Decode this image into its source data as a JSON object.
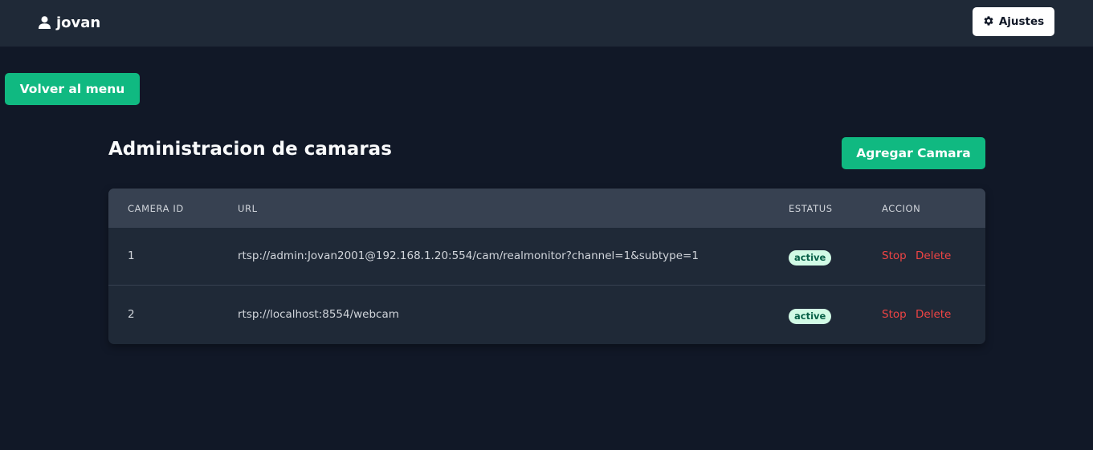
{
  "header": {
    "username": "jovan",
    "user_icon": "user-icon",
    "settings_icon": "gear-icon",
    "settings_label": "Ajustes"
  },
  "back_button_label": "Volver al menu",
  "page": {
    "title": "Administracion de camaras",
    "add_button_label": "Agregar Camara"
  },
  "table": {
    "columns": [
      "CAMERA ID",
      "URL",
      "ESTATUS",
      "ACCION"
    ],
    "rows": [
      {
        "id": "1",
        "url": "rtsp://admin:Jovan2001@192.168.1.20:554/cam/realmonitor?channel=1&subtype=1",
        "status": "active",
        "actions": [
          "Stop",
          "Delete"
        ]
      },
      {
        "id": "2",
        "url": "rtsp://localhost:8554/webcam",
        "status": "active",
        "actions": [
          "Stop",
          "Delete"
        ]
      }
    ]
  },
  "colors": {
    "background": "#111827",
    "header_bg": "#1f2937",
    "accent": "#10b981",
    "danger": "#ef4444",
    "badge_bg": "#d1fae5",
    "badge_text": "#065f46"
  }
}
